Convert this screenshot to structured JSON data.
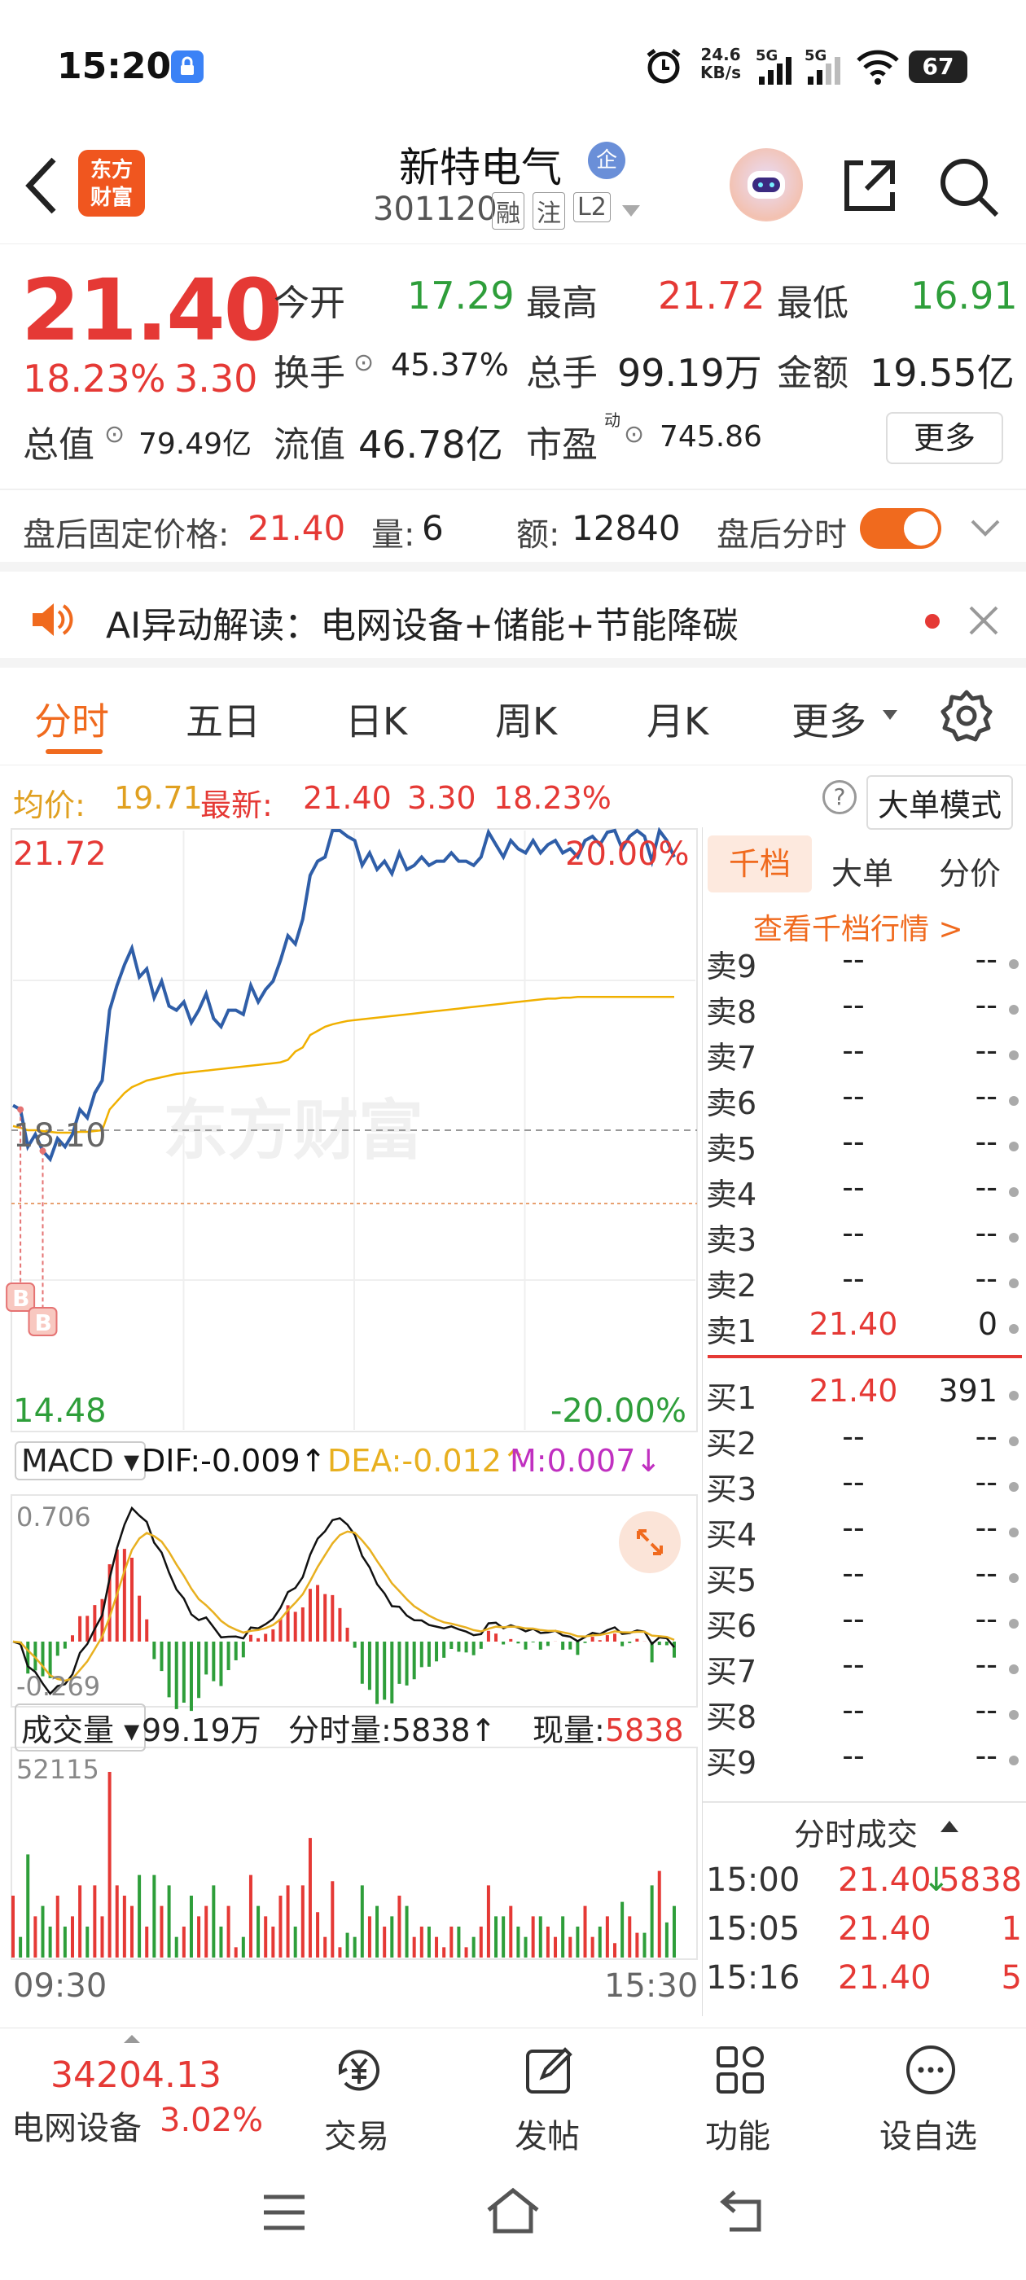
{
  "status": {
    "time": "15:20",
    "net_speed_value": "24.6",
    "net_speed_unit": "KB/s",
    "sig1": "5G",
    "sig2": "5G",
    "battery": "67"
  },
  "header": {
    "logo_line1": "东方",
    "logo_line2": "财富",
    "stock_name": "新特电气",
    "enterprise_badge": "企",
    "stock_code": "301120",
    "tags": [
      "融",
      "注",
      "L2"
    ]
  },
  "quote": {
    "price": "21.40",
    "change_pct": "18.23%",
    "change": "3.30",
    "metrics": [
      {
        "label": "今开",
        "value": "17.29"
      },
      {
        "label": "最高",
        "value": "21.72"
      },
      {
        "label": "最低",
        "value": "16.91"
      },
      {
        "label": "换手",
        "value": "45.37%"
      },
      {
        "label": "总手",
        "value": "99.19万"
      },
      {
        "label": "金额",
        "value": "19.55亿"
      },
      {
        "label": "总值",
        "value": "79.49亿"
      },
      {
        "label": "流值",
        "value": "46.78亿"
      },
      {
        "label": "市盈",
        "sup": "动",
        "value": "745.86"
      }
    ],
    "more_btn": "更多"
  },
  "after_hours": {
    "price_label": "盘后固定价格:",
    "price": "21.40",
    "vol_label": "量:",
    "vol": "6",
    "amt_label": "额:",
    "amt": "12840",
    "toggle_label": "盘后分时",
    "toggle_on": true
  },
  "ai_bar": {
    "text": "AI异动解读：电网设备+储能+节能降碳"
  },
  "tabs": [
    "分时",
    "五日",
    "日K",
    "周K",
    "月K",
    "更多"
  ],
  "summary": {
    "avg_label": "均价:",
    "avg": "19.71",
    "latest_label": "最新:",
    "latest": "21.40",
    "chg": "3.30",
    "chg_pct": "18.23%",
    "mode_btn": "大单模式"
  },
  "chart_labels": {
    "top_price": "21.72",
    "top_pct": "20.00%",
    "mid_price": "18.10",
    "bottom_price": "14.48",
    "bottom_pct": "-20.00%",
    "buy_marker": "B",
    "watermark": "东方财富"
  },
  "macd": {
    "selector": "MACD",
    "dif": "DIF:-0.009",
    "dea": "DEA:-0.012",
    "m": "M:0.007",
    "dif_arrow": "↑",
    "dea_arrow": "↑",
    "m_arrow": "↓",
    "max": "0.706",
    "min": "-0.269"
  },
  "volume": {
    "selector": "成交量",
    "total": "99.19万",
    "tick_label": "分时量:5838",
    "tick_arrow": "↑",
    "now_label": "现量:",
    "now": "5838",
    "max": "52115",
    "time_start": "09:30",
    "time_end": "15:30"
  },
  "orderbook": {
    "tabs": [
      "千档",
      "大单",
      "分价"
    ],
    "link": "查看千档行情 >",
    "asks": [
      {
        "label": "卖9",
        "price": "--",
        "vol": "--"
      },
      {
        "label": "卖8",
        "price": "--",
        "vol": "--"
      },
      {
        "label": "卖7",
        "price": "--",
        "vol": "--"
      },
      {
        "label": "卖6",
        "price": "--",
        "vol": "--"
      },
      {
        "label": "卖5",
        "price": "--",
        "vol": "--"
      },
      {
        "label": "卖4",
        "price": "--",
        "vol": "--"
      },
      {
        "label": "卖3",
        "price": "--",
        "vol": "--"
      },
      {
        "label": "卖2",
        "price": "--",
        "vol": "--"
      },
      {
        "label": "卖1",
        "price": "21.40",
        "vol": "0"
      }
    ],
    "bids": [
      {
        "label": "买1",
        "price": "21.40",
        "vol": "391"
      },
      {
        "label": "买2",
        "price": "--",
        "vol": "--"
      },
      {
        "label": "买3",
        "price": "--",
        "vol": "--"
      },
      {
        "label": "买4",
        "price": "--",
        "vol": "--"
      },
      {
        "label": "买5",
        "price": "--",
        "vol": "--"
      },
      {
        "label": "买6",
        "price": "--",
        "vol": "--"
      },
      {
        "label": "买7",
        "price": "--",
        "vol": "--"
      },
      {
        "label": "买8",
        "price": "--",
        "vol": "--"
      },
      {
        "label": "买9",
        "price": "--",
        "vol": "--"
      }
    ],
    "ticks_title": "分时成交",
    "ticks": [
      {
        "time": "15:00",
        "price": "21.40",
        "arrow": "↓",
        "vol": "5838"
      },
      {
        "time": "15:05",
        "price": "21.40",
        "arrow": "",
        "vol": "1"
      },
      {
        "time": "15:16",
        "price": "21.40",
        "arrow": "",
        "vol": "5"
      }
    ]
  },
  "bottom_nav": {
    "index_value": "34204.13",
    "sector_name": "电网设备",
    "sector_pct": "3.02%",
    "items": [
      "交易",
      "发帖",
      "功能",
      "设自选"
    ]
  },
  "chart_data": {
    "type": "line",
    "title": "",
    "xlabel": "",
    "ylabel": "",
    "x_range": [
      "09:30",
      "15:30"
    ],
    "ylim": [
      14.48,
      21.72
    ],
    "prev_close": 18.1,
    "series": [
      {
        "name": "最新",
        "values": [
          18.4,
          18.35,
          17.9,
          18.05,
          17.85,
          17.75,
          18.0,
          17.9,
          18.05,
          18.35,
          18.25,
          18.55,
          18.7,
          19.55,
          19.85,
          20.1,
          20.3,
          19.95,
          20.05,
          19.7,
          19.9,
          19.6,
          19.55,
          19.65,
          19.4,
          19.55,
          19.75,
          19.45,
          19.35,
          19.55,
          19.55,
          19.5,
          19.85,
          19.65,
          19.8,
          19.9,
          20.15,
          20.45,
          20.35,
          20.65,
          21.18,
          21.35,
          21.4,
          21.72,
          21.72,
          21.65,
          21.6,
          21.3,
          21.45,
          21.25,
          21.35,
          21.2,
          21.45,
          21.25,
          21.3,
          21.4,
          21.3,
          21.35,
          21.35,
          21.45,
          21.35,
          21.35,
          21.3,
          21.4,
          21.7,
          21.55,
          21.4,
          21.6,
          21.5,
          21.45,
          21.6,
          21.45,
          21.55,
          21.6,
          21.45,
          21.5,
          21.4,
          21.6,
          21.65,
          21.55,
          21.7,
          21.72,
          21.5,
          21.65,
          21.72,
          21.65,
          21.35,
          21.72,
          21.6,
          21.4
        ]
      },
      {
        "name": "均价",
        "values": [
          18.15,
          18.13,
          18.1,
          18.1,
          18.09,
          18.08,
          18.07,
          18.07,
          18.07,
          18.08,
          18.08,
          18.09,
          18.1,
          18.35,
          18.45,
          18.55,
          18.62,
          18.66,
          18.7,
          18.72,
          18.74,
          18.76,
          18.78,
          18.79,
          18.8,
          18.81,
          18.82,
          18.83,
          18.84,
          18.85,
          18.86,
          18.87,
          18.88,
          18.89,
          18.9,
          18.91,
          18.92,
          18.95,
          19.05,
          19.1,
          19.25,
          19.3,
          19.35,
          19.38,
          19.4,
          19.42,
          19.43,
          19.44,
          19.45,
          19.46,
          19.47,
          19.48,
          19.49,
          19.5,
          19.51,
          19.52,
          19.53,
          19.54,
          19.55,
          19.56,
          19.57,
          19.58,
          19.59,
          19.6,
          19.61,
          19.62,
          19.63,
          19.64,
          19.65,
          19.66,
          19.67,
          19.68,
          19.69,
          19.69,
          19.7,
          19.7,
          19.71,
          19.71,
          19.71,
          19.71,
          19.71,
          19.71,
          19.71,
          19.71,
          19.71,
          19.71,
          19.71,
          19.71,
          19.71,
          19.71
        ]
      }
    ],
    "buy_markers": [
      1,
      4
    ]
  }
}
